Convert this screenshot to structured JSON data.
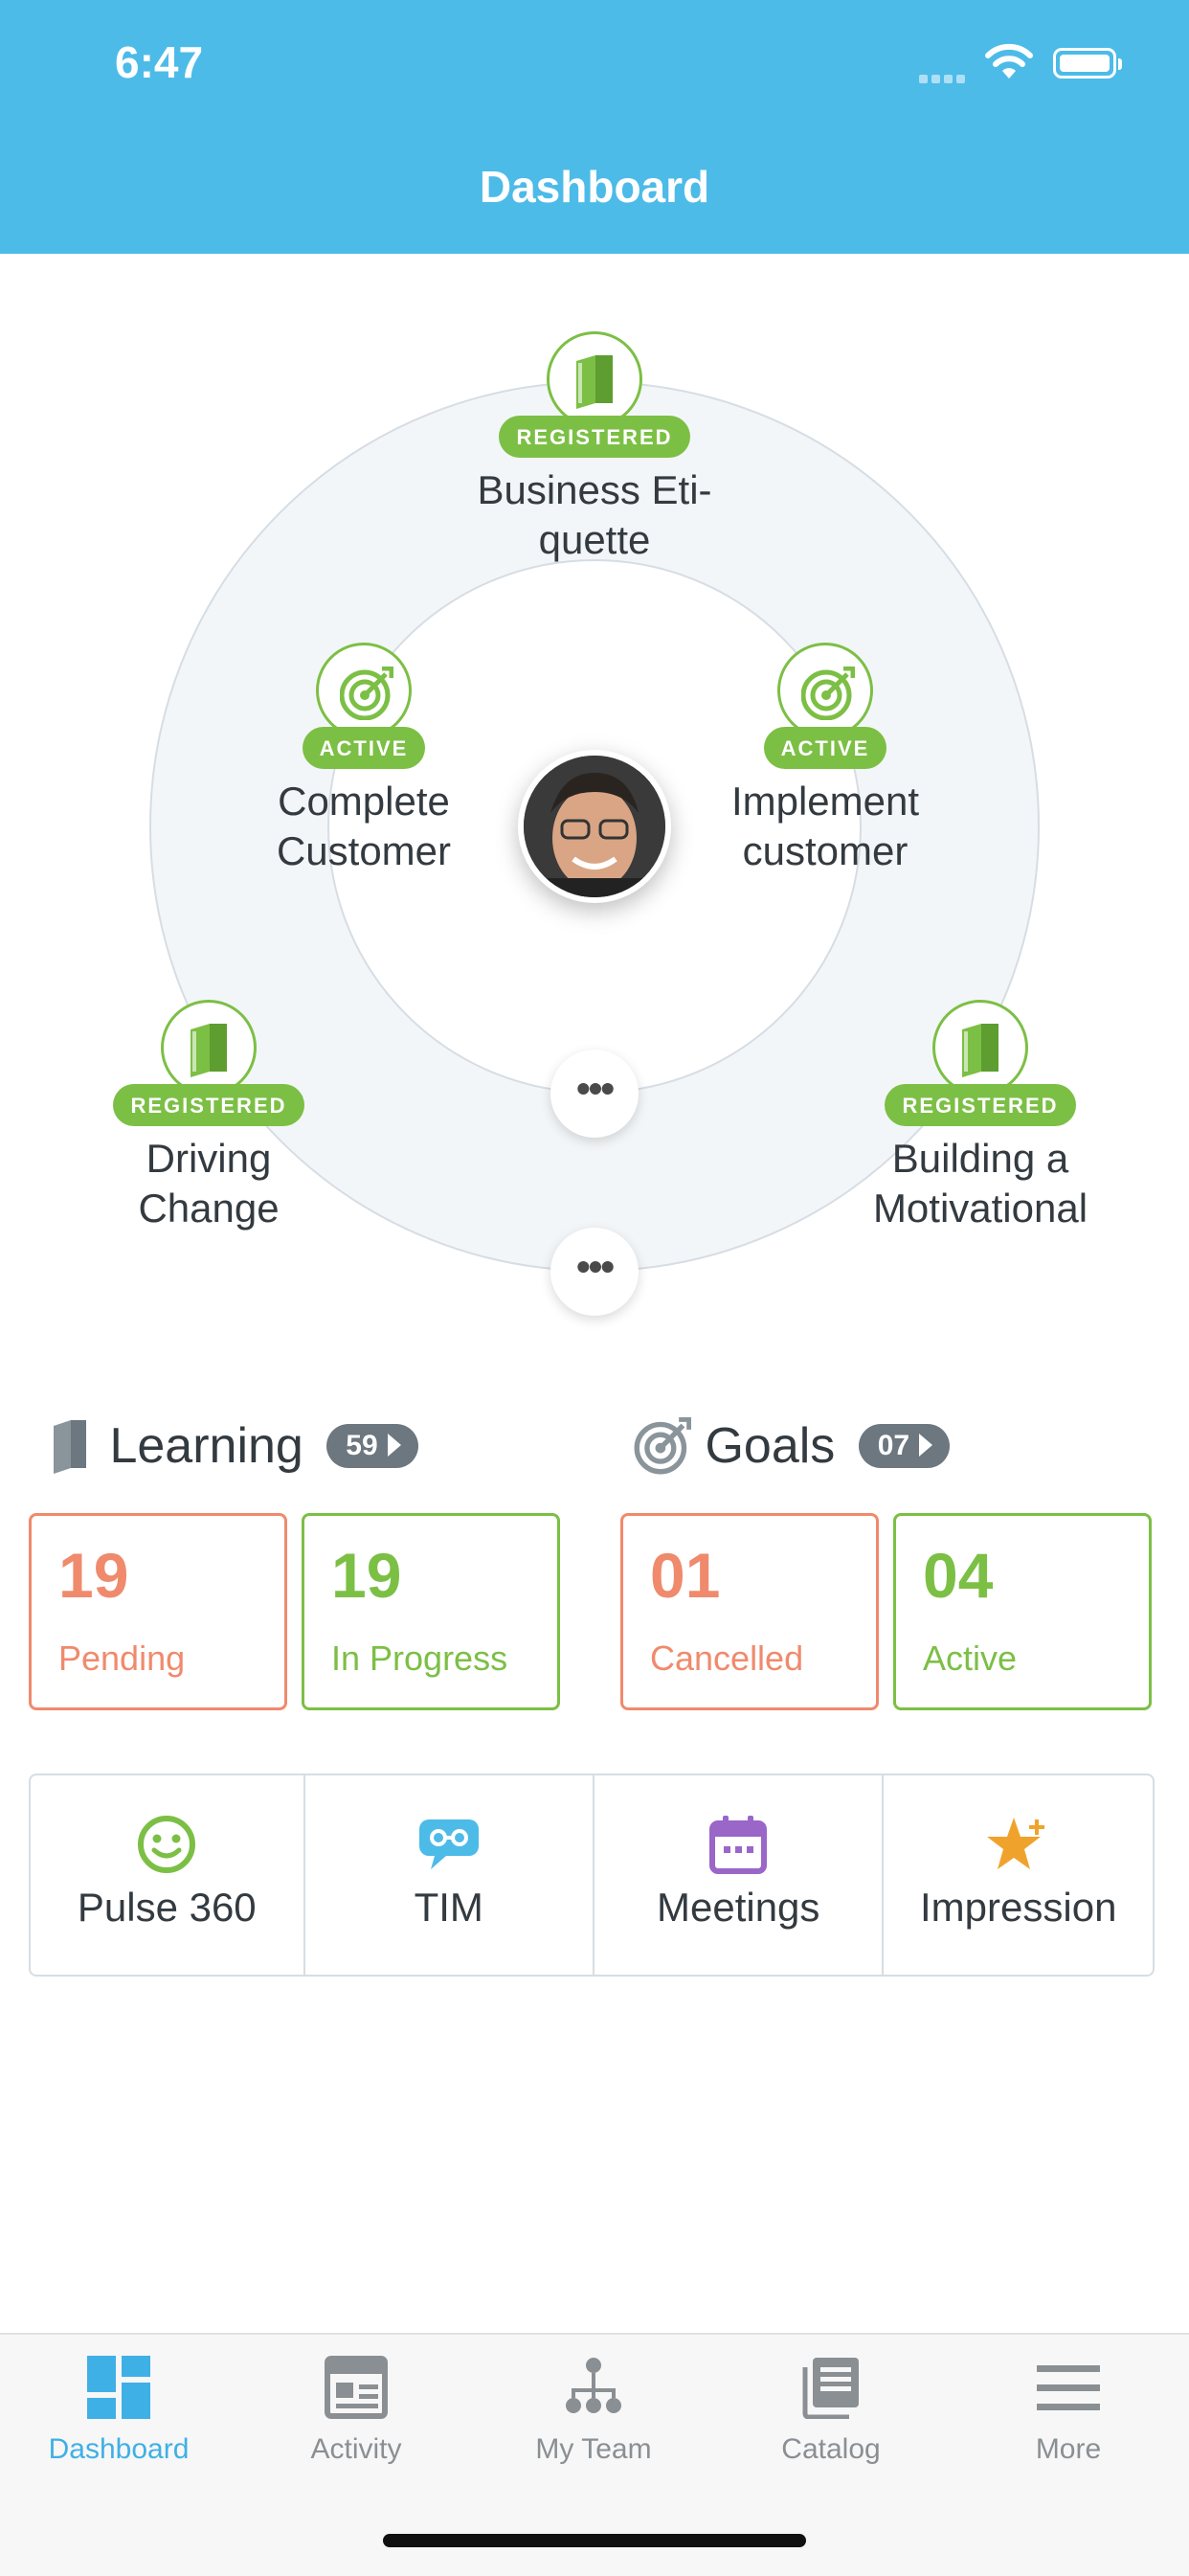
{
  "status_bar": {
    "time": "6:47"
  },
  "header": {
    "title": "Dashboard"
  },
  "colors": {
    "accent": "#4dbbe8",
    "green": "#7cbf45",
    "orange": "#f08a6d",
    "badge_gray": "#6c777f"
  },
  "orbit": {
    "nodes": [
      {
        "badge": "REGISTERED",
        "title_line1": "Business Eti-",
        "title_line2": "quette",
        "icon": "book-icon"
      },
      {
        "badge": "ACTIVE",
        "title_line1": "Complete",
        "title_line2": "Customer",
        "icon": "target-icon"
      },
      {
        "badge": "ACTIVE",
        "title_line1": "Implement",
        "title_line2": "customer",
        "icon": "target-icon"
      },
      {
        "badge": "REGISTERED",
        "title_line1": "Driving",
        "title_line2": "Change",
        "icon": "book-icon"
      },
      {
        "badge": "REGISTERED",
        "title_line1": "Building a",
        "title_line2": "Motivational",
        "icon": "book-icon"
      }
    ],
    "more_label": "•••"
  },
  "learning": {
    "label": "Learning",
    "count": "59",
    "stats": [
      {
        "value": "19",
        "caption": "Pending"
      },
      {
        "value": "19",
        "caption": "In Progress"
      }
    ]
  },
  "goals": {
    "label": "Goals",
    "count": "07",
    "stats": [
      {
        "value": "01",
        "caption": "Cancelled"
      },
      {
        "value": "04",
        "caption": "Active"
      }
    ]
  },
  "tools": [
    {
      "label": "Pulse 360",
      "icon": "smiley-icon"
    },
    {
      "label": "TIM",
      "icon": "chat-glasses-icon"
    },
    {
      "label": "Meetings",
      "icon": "calendar-icon"
    },
    {
      "label": "Impression",
      "icon": "star-plus-icon"
    }
  ],
  "tab_bar": {
    "tabs": [
      {
        "label": "Dashboard",
        "icon": "dashboard-icon",
        "active": true
      },
      {
        "label": "Activity",
        "icon": "activity-icon",
        "active": false
      },
      {
        "label": "My Team",
        "icon": "team-icon",
        "active": false
      },
      {
        "label": "Catalog",
        "icon": "catalog-icon",
        "active": false
      },
      {
        "label": "More",
        "icon": "menu-icon",
        "active": false
      }
    ]
  }
}
